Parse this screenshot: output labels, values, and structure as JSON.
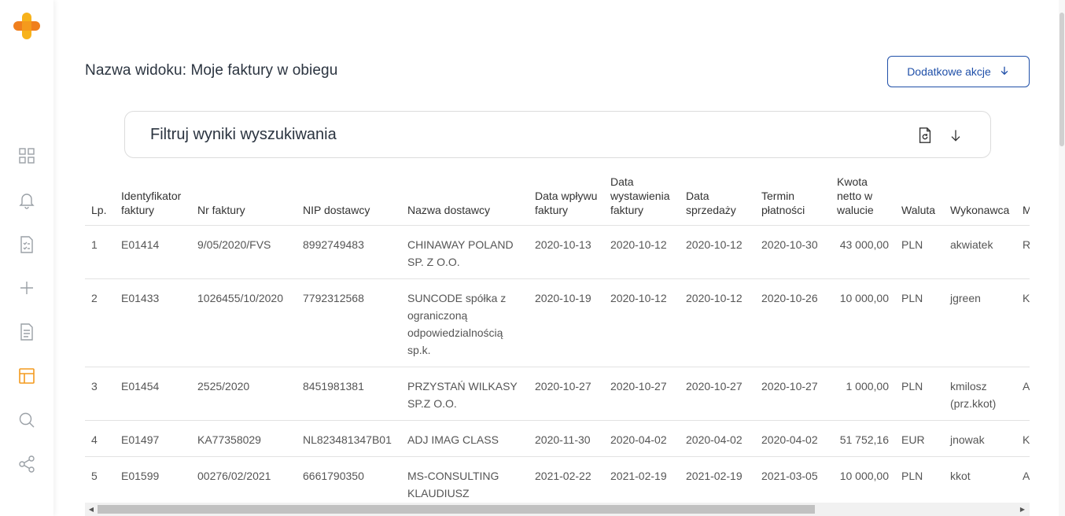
{
  "sidebar": {
    "items": [
      {
        "name": "dashboard",
        "icon": "grid-icon"
      },
      {
        "name": "notifications",
        "icon": "bell-icon"
      },
      {
        "name": "tasks",
        "icon": "checklist-icon"
      },
      {
        "name": "add",
        "icon": "plus-icon"
      },
      {
        "name": "documents",
        "icon": "document-icon"
      },
      {
        "name": "views",
        "icon": "layout-icon",
        "active": true
      },
      {
        "name": "search",
        "icon": "search-icon"
      },
      {
        "name": "share",
        "icon": "share-icon"
      }
    ],
    "accent": "#f39a1e"
  },
  "header": {
    "title": "Nazwa widoku: Moje faktury w obiegu",
    "actions_label": "Dodatkowe akcje"
  },
  "filter": {
    "title": "Filtruj wyniki wyszukiwania"
  },
  "table": {
    "columns": [
      "Lp.",
      "Identyfikator faktury",
      "Nr faktury",
      "NIP dostawcy",
      "Nazwa dostawcy",
      "Data wpływu faktury",
      "Data wystawienia faktury",
      "Data sprzedaży",
      "Termin płatności",
      "Kwota netto w walucie",
      "Waluta",
      "Wykonawca",
      "M z"
    ],
    "rows": [
      [
        "1",
        "E01414",
        "9/05/2020/FVS",
        "8992749483",
        "CHINAWAY POLAND SP. Z O.O.",
        "2020-10-13",
        "2020-10-12",
        "2020-10-12",
        "2020-10-30",
        "43 000,00",
        "PLN",
        "akwiatek",
        "R fa"
      ],
      [
        "2",
        "E01433",
        "1026455/10/2020",
        "7792312568",
        "SUNCODE spółka z ograniczoną odpowiedzialnością sp.k.",
        "2020-10-19",
        "2020-10-12",
        "2020-10-12",
        "2020-10-26",
        "10 000,00",
        "PLN",
        "jgreen",
        "K"
      ],
      [
        "3",
        "E01454",
        "2525/2020",
        "8451981381",
        "PRZYSTAŃ WILKASY SP.Z O.O.",
        "2020-10-27",
        "2020-10-27",
        "2020-10-27",
        "2020-10-27",
        "1 000,00",
        "PLN",
        "kmilosz (prz.kkot)",
        "A fa"
      ],
      [
        "4",
        "E01497",
        "KA77358029",
        "NL823481347B01",
        "ADJ IMAG CLASS",
        "2020-11-30",
        "2020-04-02",
        "2020-04-02",
        "2020-04-02",
        "51 752,16",
        "EUR",
        "jnowak",
        "K"
      ],
      [
        "5",
        "E01599",
        "00276/02/2021",
        "6661790350",
        "MS-CONSULTING KLAUDIUSZ SZYMCZAK",
        "2021-02-22",
        "2021-02-19",
        "2021-02-19",
        "2021-03-05",
        "10 000,00",
        "PLN",
        "kkot",
        "A fa"
      ]
    ]
  }
}
